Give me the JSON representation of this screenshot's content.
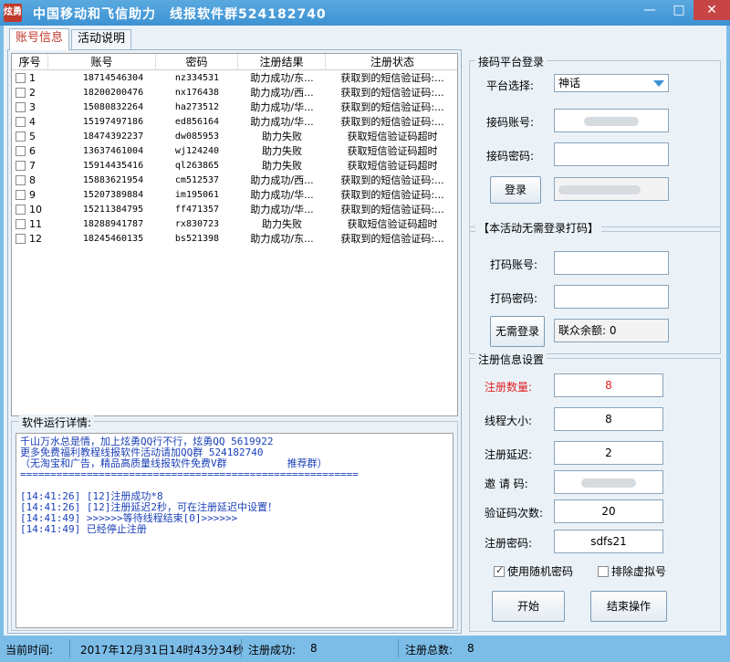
{
  "app": {
    "logo": "炫勇",
    "title": "中国移动和飞信助力　线报软件群524182740"
  },
  "window": {
    "minimize": "—",
    "maximize": "□",
    "close": "✕"
  },
  "tabs": [
    {
      "label": "账号信息"
    },
    {
      "label": "活动说明"
    }
  ],
  "table": {
    "headers": [
      "序号",
      "账号",
      "密码",
      "注册结果",
      "注册状态"
    ],
    "rows": [
      {
        "no": "1",
        "account": "18714546304",
        "password": "nz334531",
        "result": "助力成功/东...",
        "status": "获取到的短信验证码:..."
      },
      {
        "no": "2",
        "account": "18200200476",
        "password": "nx176438",
        "result": "助力成功/西...",
        "status": "获取到的短信验证码:..."
      },
      {
        "no": "3",
        "account": "15080832264",
        "password": "ha273512",
        "result": "助力成功/华...",
        "status": "获取到的短信验证码:..."
      },
      {
        "no": "4",
        "account": "15197497186",
        "password": "ed856164",
        "result": "助力成功/华...",
        "status": "获取到的短信验证码:..."
      },
      {
        "no": "5",
        "account": "18474392237",
        "password": "dw085953",
        "result": "助力失败",
        "status": "获取短信验证码超时"
      },
      {
        "no": "6",
        "account": "13637461004",
        "password": "wj124240",
        "result": "助力失败",
        "status": "获取短信验证码超时"
      },
      {
        "no": "7",
        "account": "15914435416",
        "password": "ql263865",
        "result": "助力失败",
        "status": "获取短信验证码超时"
      },
      {
        "no": "8",
        "account": "15883621954",
        "password": "cm512537",
        "result": "助力成功/西...",
        "status": "获取到的短信验证码:..."
      },
      {
        "no": "9",
        "account": "15207389884",
        "password": "im195061",
        "result": "助力成功/华...",
        "status": "获取到的短信验证码:..."
      },
      {
        "no": "10",
        "account": "15211384795",
        "password": "ff471357",
        "result": "助力成功/华...",
        "status": "获取到的短信验证码:..."
      },
      {
        "no": "11",
        "account": "18288941787",
        "password": "rx830723",
        "result": "助力失败",
        "status": "获取短信验证码超时"
      },
      {
        "no": "12",
        "account": "18245460135",
        "password": "bs521398",
        "result": "助力成功/东...",
        "status": "获取到的短信验证码:..."
      }
    ]
  },
  "log": {
    "label": "软件运行详情:",
    "lines": [
      "千山万水总是情，加上炫勇QQ行不行，炫勇QQ 5619922",
      "更多免费福利教程线报软件活动请加QQ群 524182740",
      "（无淘宝和广告，精品高质量线报软件免费V群　　　　　　推荐群）",
      "========================================================",
      "",
      "[14:41:26]  [12]注册成功*8",
      "[14:41:26]  [12]注册延迟2秒，可在注册延迟中设置！",
      "[14:41:49]  >>>>>>等待线程结束[0]>>>>>>",
      "[14:41:49]  已经停止注册"
    ]
  },
  "platform": {
    "title": "接码平台登录",
    "platform_label": "平台选择:",
    "platform_value": "神话",
    "account_label": "接码账号:",
    "password_label": "接码密码:",
    "login_button": "登录"
  },
  "captcha": {
    "title": "【本活动无需登录打码】",
    "account_label": "打码账号:",
    "password_label": "打码密码:",
    "no_login_button": "无需登录",
    "balance": "联众余额: 0"
  },
  "register": {
    "title": "注册信息设置",
    "count_label": "注册数量:",
    "count_value": "8",
    "threads_label": "线程大小:",
    "threads_value": "8",
    "delay_label": "注册延迟:",
    "delay_value": "2",
    "invite_label": "邀 请 码:",
    "verify_label": "验证码次数:",
    "verify_value": "20",
    "password_label": "注册密码:",
    "password_value": "sdfs21",
    "random_password_label": "使用随机密码",
    "exclude_virtual_label": "排除虚拟号",
    "start_button": "开始",
    "stop_button": "结束操作"
  },
  "status": {
    "time_label": "当前时间:",
    "time_value": "2017年12月31日14时43分34秒",
    "success_label": "注册成功:",
    "success_value": "8",
    "total_label": "注册总数:",
    "total_value": "8"
  }
}
